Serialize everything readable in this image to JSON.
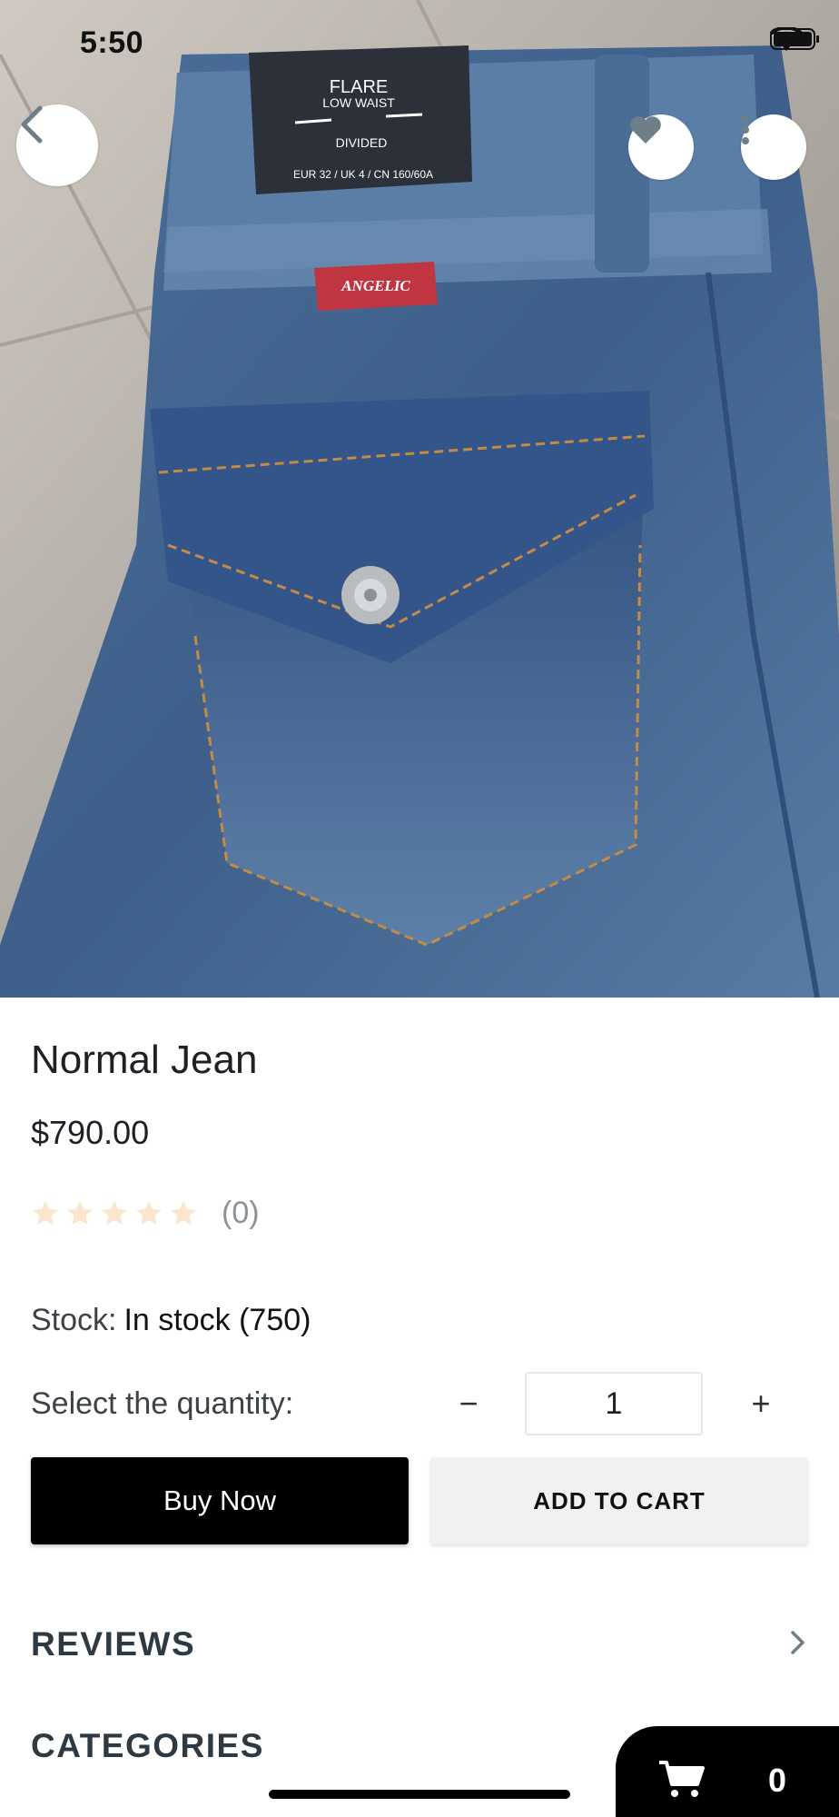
{
  "status_bar": {
    "time": "5:50"
  },
  "product_image": {
    "tag_line1": "FLARE",
    "tag_line2": "LOW WAIST",
    "tag_brand": "DIVIDED",
    "tag_size": "EUR 32 / UK 4 / CN 160/60A",
    "label_patch": "ANGELIC"
  },
  "product": {
    "title": "Normal Jean",
    "price": "$790.00",
    "rating_value": 0,
    "rating_max": 5,
    "rating_count": "(0)",
    "stock_label": "Stock:",
    "stock_value": "In stock (750)"
  },
  "quantity": {
    "label": "Select the quantity:",
    "minus": "−",
    "value": "1",
    "plus": "+"
  },
  "actions": {
    "buy_now": "Buy Now",
    "add_to_cart": "ADD TO CART"
  },
  "sections": {
    "reviews": "REVIEWS",
    "categories": "CATEGORIES"
  },
  "cart": {
    "count": "0"
  },
  "colors": {
    "star_empty": "#fbe5cc",
    "accent_black": "#000000",
    "button_secondary_bg": "#f0f1f3",
    "icon_gray": "#6f7f89"
  },
  "icons": {
    "back": "chevron-left-icon",
    "favorite": "heart-icon",
    "more": "more-vertical-icon",
    "reviews_chevron": "chevron-right-icon",
    "cart": "cart-icon"
  }
}
